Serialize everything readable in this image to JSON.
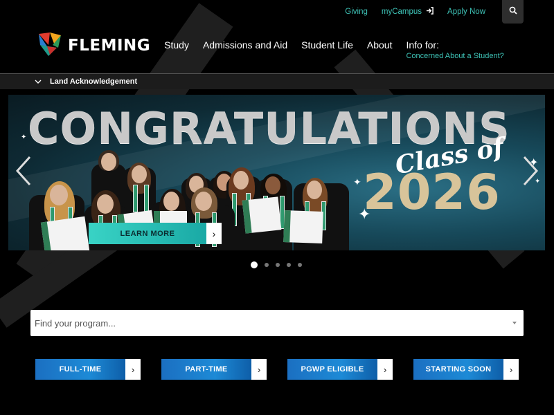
{
  "utility": {
    "giving": "Giving",
    "mycampus": "myCampus",
    "apply": "Apply Now"
  },
  "header": {
    "logo_text": "FLEMING",
    "nav": [
      "Study",
      "Admissions and Aid",
      "Student Life",
      "About"
    ],
    "info_for": "Info for:",
    "concerned": "Concerned About a Student?"
  },
  "acknowledgement": {
    "label": "Land Acknowledgement"
  },
  "hero": {
    "title": "CONGRATULATIONS",
    "subtitle": "Class of",
    "year": "2026",
    "cta": "LEARN MORE",
    "slide_count": 5,
    "active_slide": 1
  },
  "program_search": {
    "placeholder": "Find your program..."
  },
  "categories": [
    "FULL-TIME",
    "PART-TIME",
    "PGWP ELIGIBLE",
    "STARTING SOON"
  ],
  "colors": {
    "accent_teal": "#3ec3b7",
    "button_blue": "#1b6fc1",
    "year_gold": "#d8c49a"
  },
  "icons": {
    "search": "search-icon",
    "login": "login-icon",
    "chevron_down": "chevron-down-icon",
    "arrow_right": "arrow-right-icon",
    "prev": "chevron-left-icon",
    "next": "chevron-right-icon"
  }
}
